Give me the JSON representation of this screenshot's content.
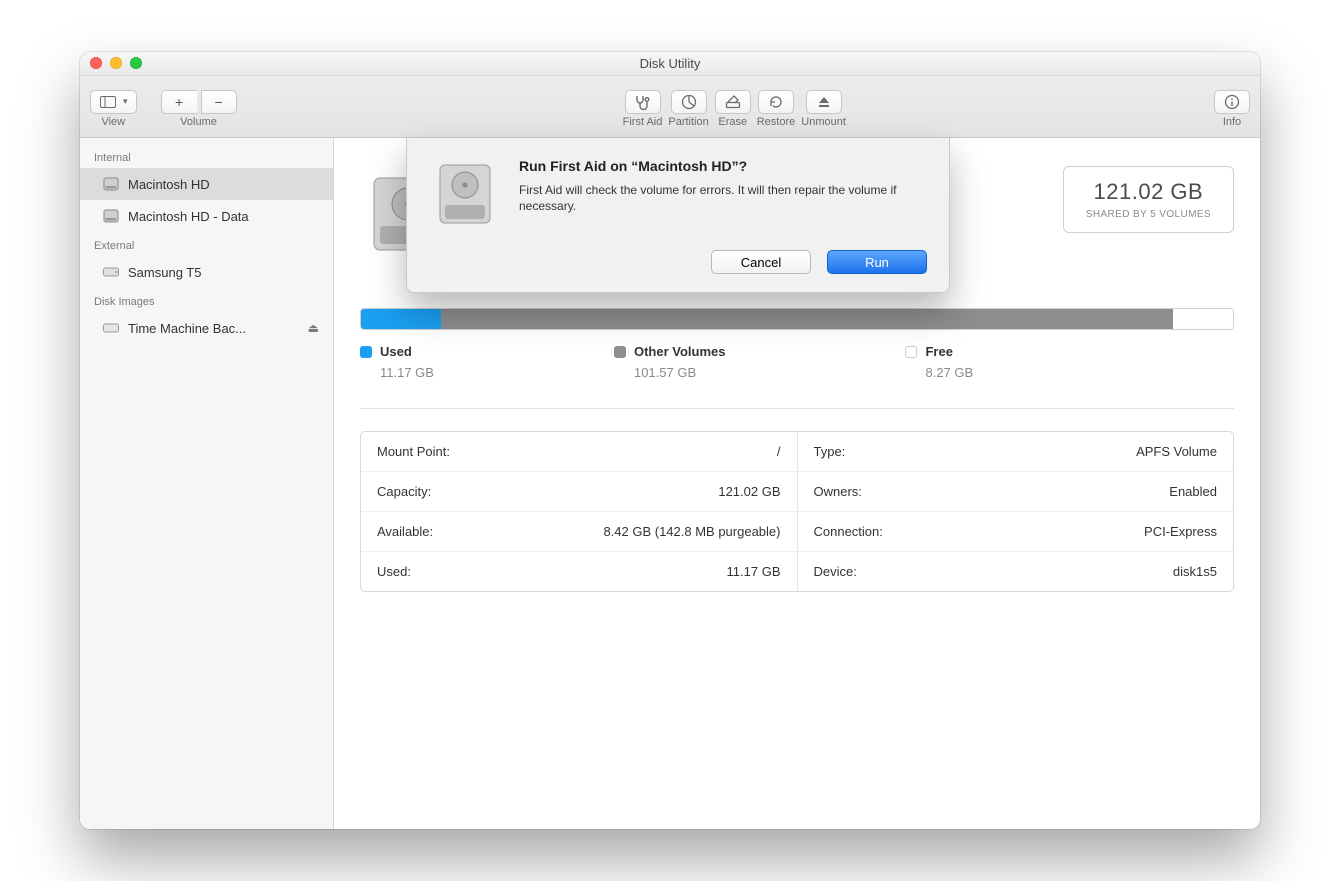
{
  "window": {
    "title": "Disk Utility"
  },
  "toolbar": {
    "view": "View",
    "volume": "Volume",
    "first_aid": "First Aid",
    "partition": "Partition",
    "erase": "Erase",
    "restore": "Restore",
    "unmount": "Unmount",
    "info": "Info"
  },
  "sidebar": {
    "internal_head": "Internal",
    "external_head": "External",
    "diskimages_head": "Disk Images",
    "internal": [
      {
        "label": "Macintosh HD",
        "selected": true
      },
      {
        "label": "Macintosh HD - Data",
        "selected": false
      }
    ],
    "external": [
      {
        "label": "Samsung T5"
      }
    ],
    "diskimages": [
      {
        "label": "Time Machine Bac...",
        "ejectable": true
      }
    ]
  },
  "volume": {
    "size": "121.02 GB",
    "shared": "SHARED BY 5 VOLUMES"
  },
  "usage": {
    "used_pct": 9.2,
    "other_pct": 83.9,
    "free_pct": 6.9,
    "legend": {
      "used_label": "Used",
      "used_val": "11.17 GB",
      "other_label": "Other Volumes",
      "other_val": "101.57 GB",
      "free_label": "Free",
      "free_val": "8.27 GB"
    }
  },
  "details_left": [
    {
      "k": "Mount Point:",
      "v": "/"
    },
    {
      "k": "Capacity:",
      "v": "121.02 GB"
    },
    {
      "k": "Available:",
      "v": "8.42 GB (142.8 MB purgeable)"
    },
    {
      "k": "Used:",
      "v": "11.17 GB"
    }
  ],
  "details_right": [
    {
      "k": "Type:",
      "v": "APFS Volume"
    },
    {
      "k": "Owners:",
      "v": "Enabled"
    },
    {
      "k": "Connection:",
      "v": "PCI-Express"
    },
    {
      "k": "Device:",
      "v": "disk1s5"
    }
  ],
  "dialog": {
    "title": "Run First Aid on “Macintosh HD”?",
    "body": "First Aid will check the volume for errors. It will then repair the volume if necessary.",
    "cancel": "Cancel",
    "run": "Run"
  }
}
